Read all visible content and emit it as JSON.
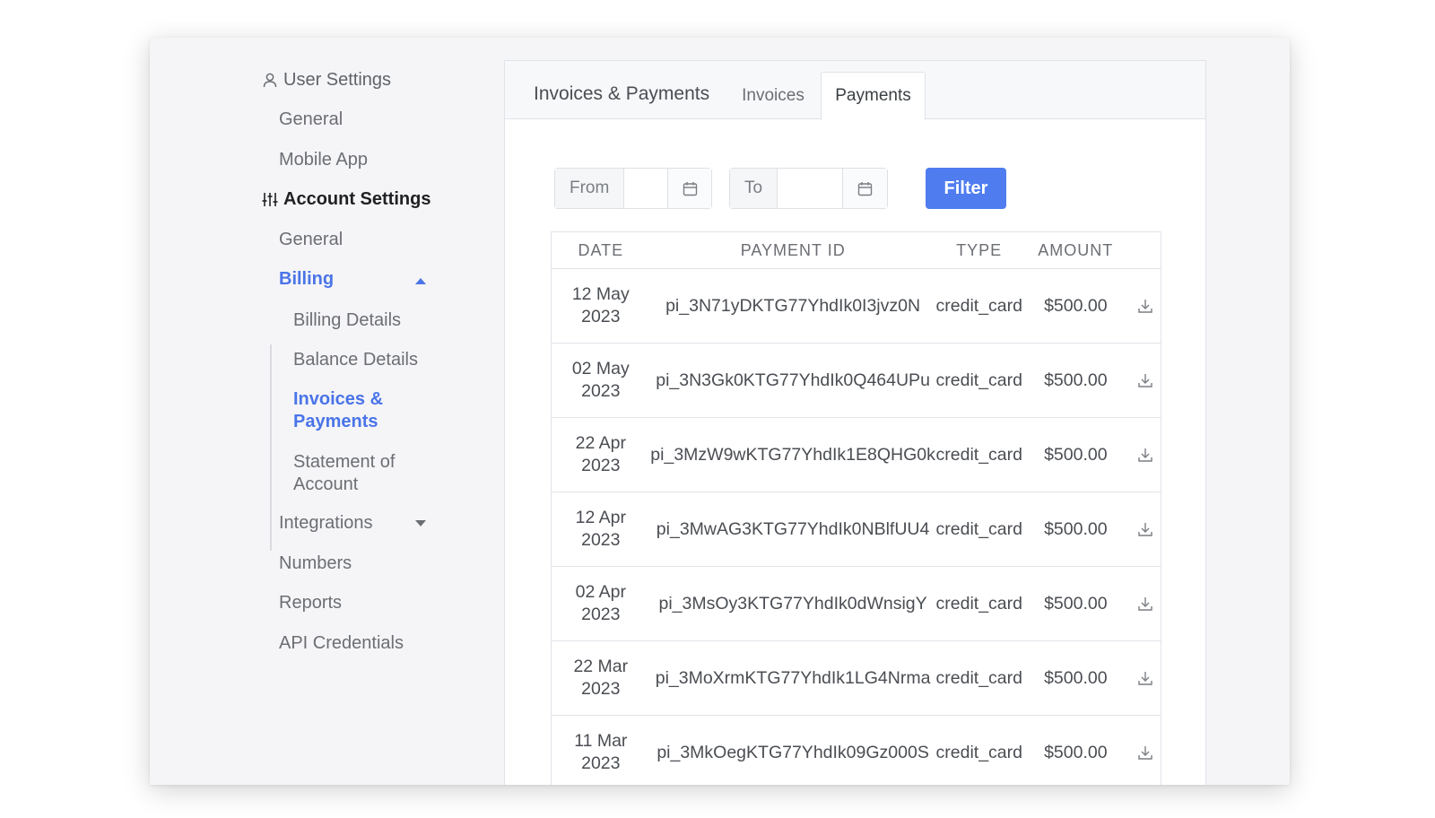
{
  "sidebar": {
    "user_settings": {
      "label": "User Settings",
      "icon": "user-icon"
    },
    "user_items": [
      "General",
      "Mobile App"
    ],
    "account_settings": {
      "label": "Account Settings",
      "icon": "sliders-icon"
    },
    "account_items": {
      "general": "General",
      "billing": "Billing",
      "billing_sub": [
        "Billing Details",
        "Balance Details",
        "Invoices & Payments",
        "Statement of Account"
      ],
      "integrations": "Integrations",
      "numbers": "Numbers",
      "reports": "Reports",
      "api_credentials": "API Credentials"
    }
  },
  "main": {
    "title": "Invoices & Payments",
    "tabs": [
      {
        "label": "Invoices",
        "selected": false
      },
      {
        "label": "Payments",
        "selected": true
      }
    ],
    "filters": {
      "from_label": "From",
      "from_value": "",
      "to_label": "To",
      "to_value": "",
      "filter_button": "Filter"
    },
    "table": {
      "headers": [
        "DATE",
        "PAYMENT ID",
        "TYPE",
        "AMOUNT"
      ],
      "rows": [
        {
          "date_line1": "12 May",
          "date_line2": "2023",
          "payment_id": "pi_3N71yDKTG77YhdIk0I3jvz0N",
          "type": "credit_card",
          "amount": "$500.00"
        },
        {
          "date_line1": "02 May",
          "date_line2": "2023",
          "payment_id": "pi_3N3Gk0KTG77YhdIk0Q464UPu",
          "type": "credit_card",
          "amount": "$500.00"
        },
        {
          "date_line1": "22 Apr",
          "date_line2": "2023",
          "payment_id": "pi_3MzW9wKTG77YhdIk1E8QHG0k",
          "type": "credit_card",
          "amount": "$500.00"
        },
        {
          "date_line1": "12 Apr",
          "date_line2": "2023",
          "payment_id": "pi_3MwAG3KTG77YhdIk0NBlfUU4",
          "type": "credit_card",
          "amount": "$500.00"
        },
        {
          "date_line1": "02 Apr",
          "date_line2": "2023",
          "payment_id": "pi_3MsOy3KTG77YhdIk0dWnsigY",
          "type": "credit_card",
          "amount": "$500.00"
        },
        {
          "date_line1": "22 Mar",
          "date_line2": "2023",
          "payment_id": "pi_3MoXrmKTG77YhdIk1LG4Nrma",
          "type": "credit_card",
          "amount": "$500.00"
        },
        {
          "date_line1": "11 Mar",
          "date_line2": "2023",
          "payment_id": "pi_3MkOegKTG77YhdIk09Gz000S",
          "type": "credit_card",
          "amount": "$500.00"
        }
      ]
    }
  },
  "colors": {
    "accent": "#4a74e8",
    "button": "#4f7df0",
    "background": "#f5f5f7"
  }
}
